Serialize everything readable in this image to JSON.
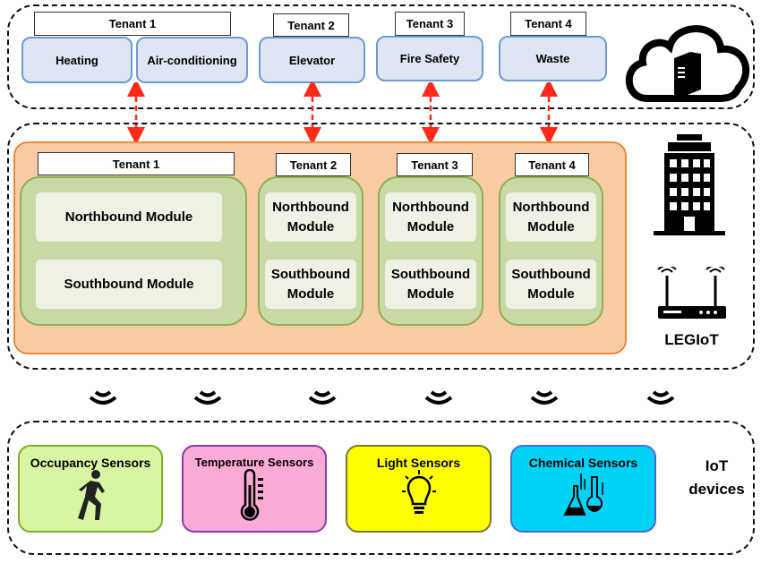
{
  "cloud": {
    "tenants": [
      {
        "label": "Tenant 1",
        "services": [
          "Heating",
          "Air-conditioning"
        ]
      },
      {
        "label": "Tenant 2",
        "services": [
          "Elevator"
        ]
      },
      {
        "label": "Tenant 3",
        "services": [
          "Fire Safety"
        ]
      },
      {
        "label": "Tenant 4",
        "services": [
          "Waste"
        ]
      }
    ]
  },
  "legiot": {
    "title": "LEGIoT",
    "tenants": [
      "Tenant 1",
      "Tenant 2",
      "Tenant 3",
      "Tenant 4"
    ],
    "northbound": "Northbound Module",
    "southbound": "Southbound Module"
  },
  "iot": {
    "title": "IoT devices",
    "sensors": [
      {
        "label": "Occupancy Sensors",
        "color": "#d8f5a2",
        "border": "#7fae2a",
        "icon": "running-person-icon"
      },
      {
        "label": "Temperature Sensors",
        "color": "#fcaad6",
        "border": "#8a3bb0",
        "icon": "thermometer-icon"
      },
      {
        "label": "Light Sensors",
        "color": "#ffff00",
        "border": "#7a7a2a",
        "icon": "lightbulb-icon"
      },
      {
        "label": "Chemical Sensors",
        "color": "#00d2f7",
        "border": "#4a6ad8",
        "icon": "chemistry-flask-icon"
      }
    ]
  },
  "colors": {
    "arrow": "#ff2a1a",
    "orange": "#f9cba4",
    "green": "#c9d9a6"
  }
}
